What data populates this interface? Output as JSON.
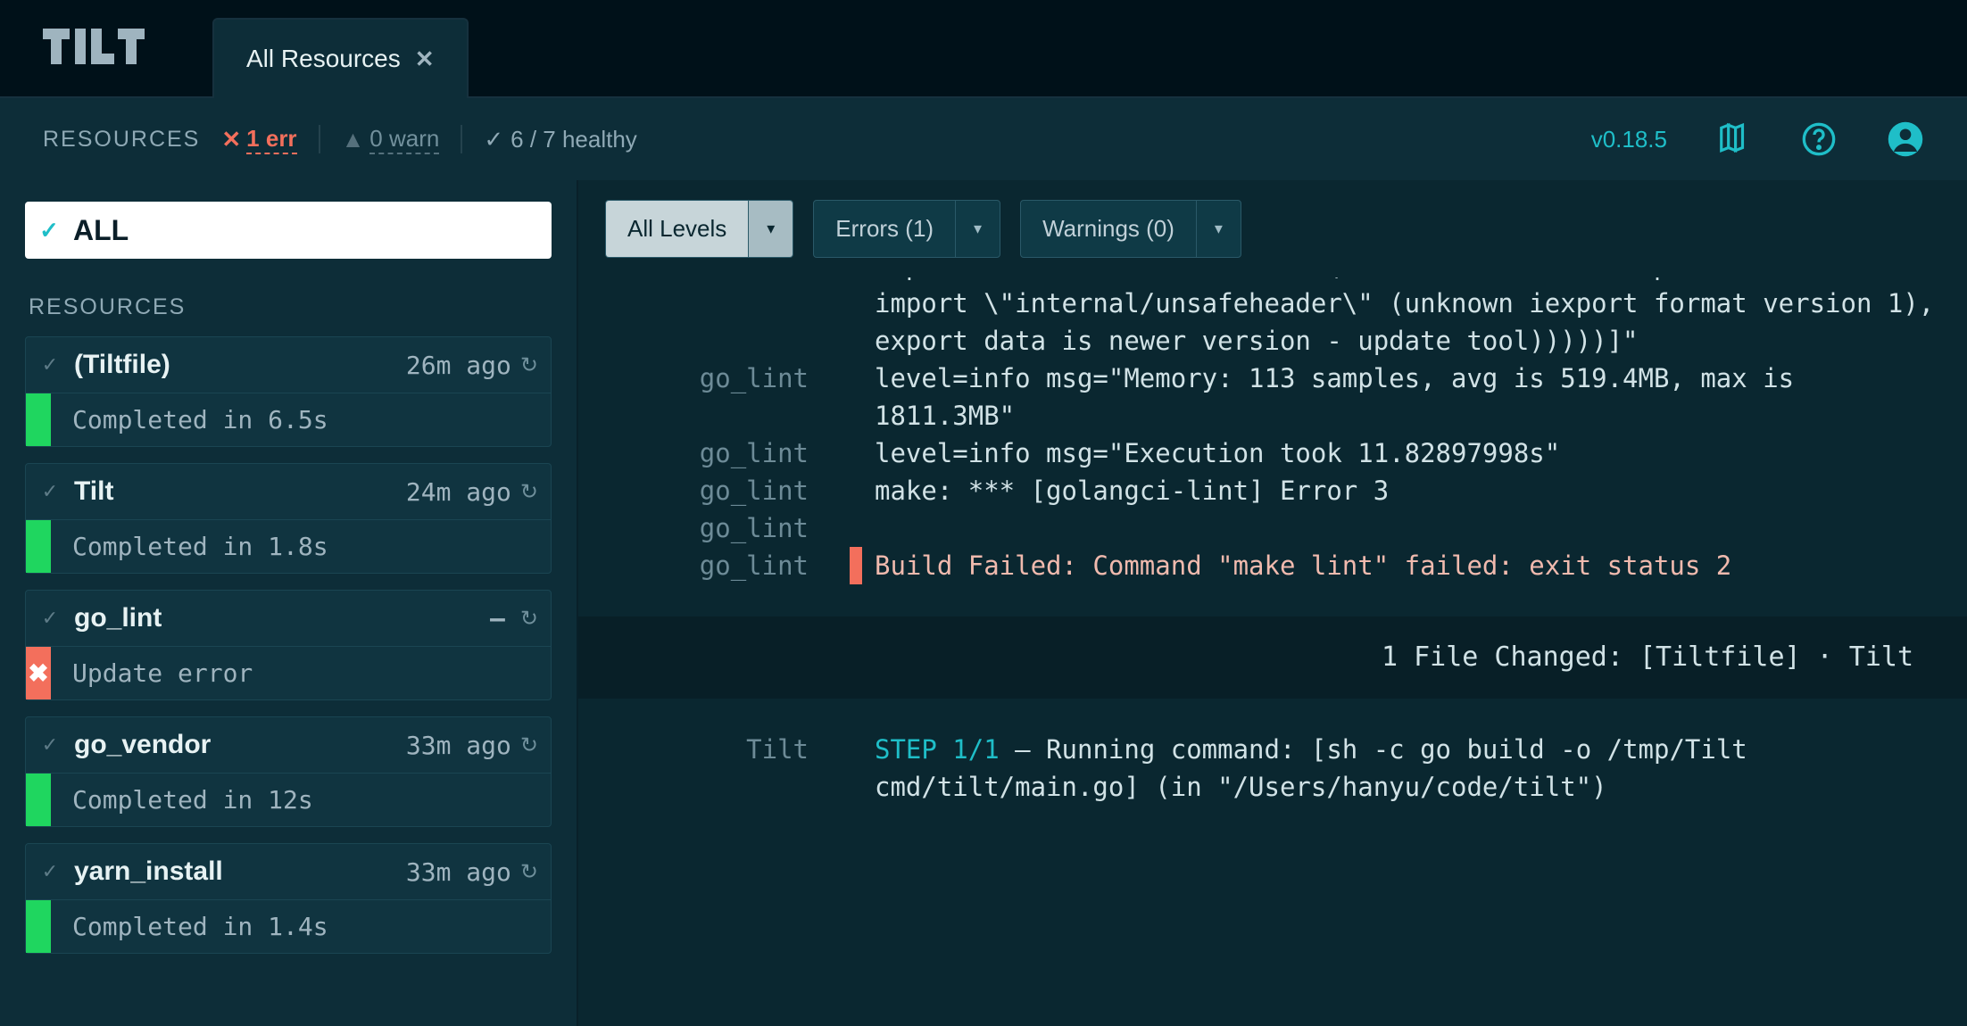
{
  "header": {
    "logo_text": "TILT",
    "tab_label": "All Resources"
  },
  "summary": {
    "label": "RESOURCES",
    "err_count": "1  err",
    "warn_count": "0  warn",
    "healthy": "6 / 7 healthy",
    "version": "v0.18.5"
  },
  "sidebar": {
    "all_label": "ALL",
    "section_label": "RESOURCES",
    "items": [
      {
        "name": "(Tiltfile)",
        "time": "26m ago",
        "status": "ok",
        "sub": "Completed in 6.5s"
      },
      {
        "name": "Tilt",
        "time": "24m ago",
        "status": "ok",
        "sub": "Completed in 1.8s"
      },
      {
        "name": "go_lint",
        "time": "–",
        "status": "err",
        "sub": "Update error"
      },
      {
        "name": "go_vendor",
        "time": "33m ago",
        "status": "ok",
        "sub": "Completed in 12s"
      },
      {
        "name": "yarn_install",
        "time": "33m ago",
        "status": "ok",
        "sub": "Completed in 1.4s"
      }
    ]
  },
  "filters": {
    "all": "All Levels",
    "errors": "Errors (1)",
    "warn": "Warnings (0)"
  },
  "logs": {
    "lines": [
      {
        "src": "",
        "gutter": "",
        "text": "import internal/unsafeheader ( : could not load export data: cannot import \\\"internal/unsafeheader\\\" (unknown iexport format version 1), export data is newer version - update tool)))))]\""
      },
      {
        "src": "go_lint",
        "gutter": "",
        "text": "level=info msg=\"Memory: 113 samples, avg is 519.4MB, max is 1811.3MB\""
      },
      {
        "src": "go_lint",
        "gutter": "",
        "text": "level=info msg=\"Execution took 11.82897998s\""
      },
      {
        "src": "go_lint",
        "gutter": "",
        "text": "make: *** [golangci-lint] Error 3"
      },
      {
        "src": "go_lint",
        "gutter": "",
        "text": ""
      },
      {
        "src": "go_lint",
        "gutter": "err",
        "text": " Build Failed: Command \"make lint\" failed: exit status 2"
      }
    ],
    "banner": "1 File Changed: [Tiltfile] · Tilt",
    "post": [
      {
        "src": "Tilt",
        "step": "STEP 1/1",
        "text": " — Running command: [sh -c go build -o /tmp/Tilt cmd/tilt/main.go] (in \"/Users/hanyu/code/tilt\")"
      }
    ]
  }
}
